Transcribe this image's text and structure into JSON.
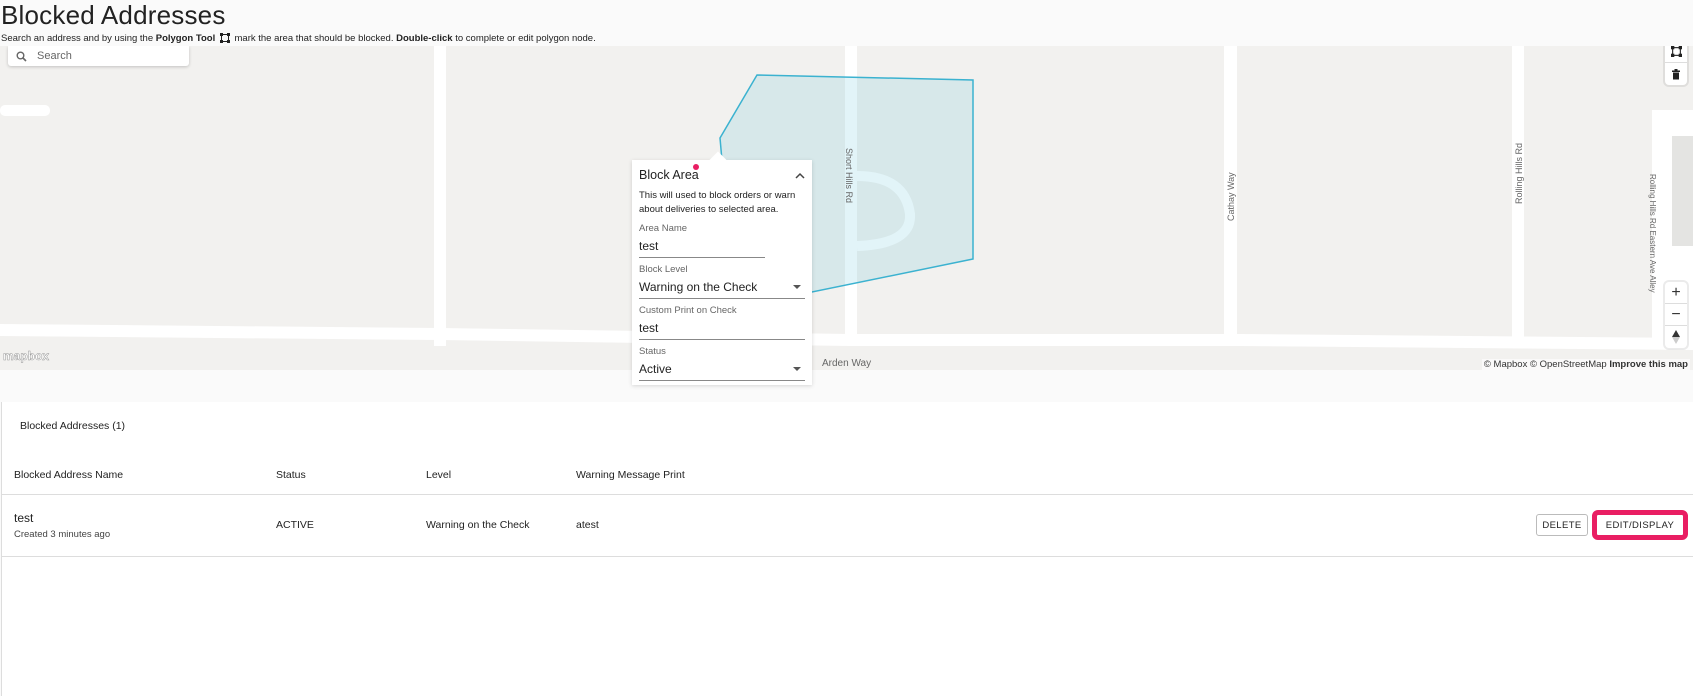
{
  "header": {
    "title": "Blocked Addresses",
    "instructions": {
      "part1": "Search an address and by using the",
      "tool_name": "Polygon Tool",
      "part2": "mark the area that should be blocked.",
      "action": "Double-click",
      "part3": "to complete or edit polygon node."
    }
  },
  "map": {
    "search_placeholder": "Search",
    "street_labels": {
      "short_hills": "Short Hills Rd",
      "cathay": "Cathay Way",
      "rolling_hills": "Rolling Hills Rd",
      "rolling_alley": "Rolling Hills Rd Eastern Ave Alley",
      "arden": "Arden Way"
    },
    "logo": "mapbox",
    "attribution": {
      "mapbox": "© Mapbox",
      "osm": "© OpenStreetMap",
      "improve": "Improve this map"
    },
    "controls": {
      "polygon_icon": "polygon-icon",
      "trash_icon": "trash-icon",
      "zoom_in": "+",
      "zoom_out": "−",
      "compass_icon": "compass-icon"
    },
    "polygon_color": "#3bb2d0"
  },
  "block_area": {
    "title": "Block Area",
    "description": "This will used to block orders or warn about deliveries to selected area.",
    "area_name": {
      "label": "Area Name",
      "value": "test"
    },
    "block_level": {
      "label": "Block Level",
      "value": "Warning on the Check"
    },
    "custom_print": {
      "label": "Custom Print on Check",
      "value": "test"
    },
    "status": {
      "label": "Status",
      "value": "Active"
    }
  },
  "table": {
    "caption": "Blocked Addresses (1)",
    "columns": [
      "Blocked Address Name",
      "Status",
      "Level",
      "Warning Message Print"
    ],
    "rows": [
      {
        "name": "test",
        "created": "Created 3 minutes ago",
        "status": "ACTIVE",
        "level": "Warning on the Check",
        "warning": "atest",
        "delete_label": "DELETE",
        "edit_label": "EDIT/DISPLAY"
      }
    ],
    "highlight_color": "#e91e63"
  }
}
